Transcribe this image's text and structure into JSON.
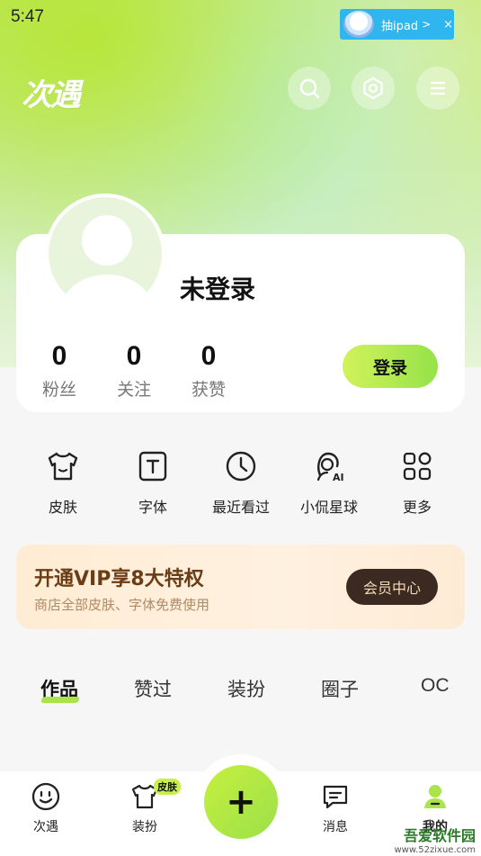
{
  "status_bar": {
    "time": "5:47"
  },
  "ad_banner": {
    "text": "抽ipad",
    "arrow": ">",
    "close": "×"
  },
  "header": {
    "logo": "次遇"
  },
  "header_icons": [
    "search-icon",
    "settings-icon",
    "menu-icon"
  ],
  "profile": {
    "username": "未登录",
    "stats": [
      {
        "value": "0",
        "label": "粉丝"
      },
      {
        "value": "0",
        "label": "关注"
      },
      {
        "value": "0",
        "label": "获赞"
      }
    ],
    "login_label": "登录"
  },
  "shortcuts": [
    {
      "label": "皮肤",
      "icon": "tshirt-icon"
    },
    {
      "label": "字体",
      "icon": "font-icon"
    },
    {
      "label": "最近看过",
      "icon": "clock-icon"
    },
    {
      "label": "小侃星球",
      "icon": "ai-avatar-icon"
    },
    {
      "label": "更多",
      "icon": "grid-icon"
    }
  ],
  "vip": {
    "title": "开通VIP享8大特权",
    "subtitle": "商店全部皮肤、字体免费使用",
    "button": "会员中心"
  },
  "tabs": [
    {
      "label": "作品",
      "active": true
    },
    {
      "label": "赞过"
    },
    {
      "label": "装扮"
    },
    {
      "label": "圈子"
    },
    {
      "label": "OC"
    }
  ],
  "bottom_nav": {
    "items": [
      {
        "label": "次遇",
        "icon": "smile-icon"
      },
      {
        "label": "装扮",
        "icon": "tshirt-icon",
        "badge": "皮肤"
      },
      {
        "label": "消息",
        "icon": "message-icon"
      },
      {
        "label": "我的",
        "icon": "profile-icon",
        "active": true
      }
    ],
    "create_label": "+"
  },
  "watermark": {
    "main": "吾爱软件园",
    "url": "www.52zixue.com"
  },
  "colors": {
    "accent": "#a9e54a",
    "vip_button": "#3b2a22"
  }
}
